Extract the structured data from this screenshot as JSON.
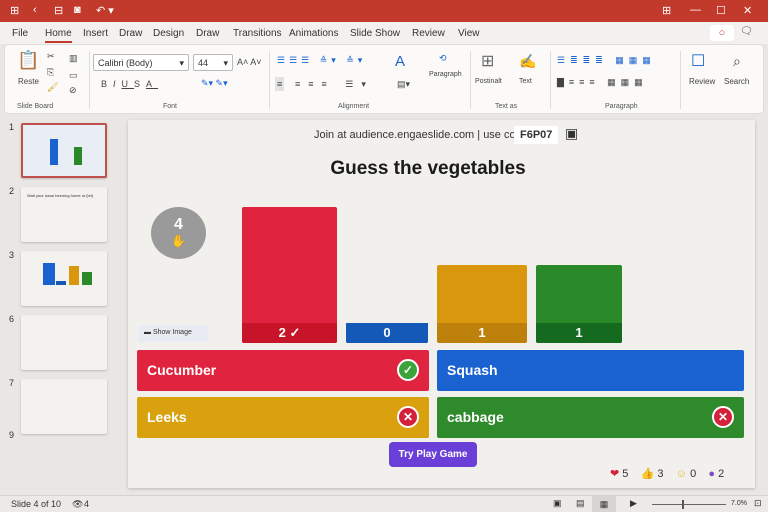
{
  "titlebar": {
    "icons": [
      "grid-icon",
      "back-icon",
      "frame-icon",
      "record-icon",
      "undo-icon"
    ],
    "window_controls": [
      "new-window",
      "minimize",
      "maximize",
      "close"
    ]
  },
  "menu": [
    "File",
    "Home",
    "Insert",
    "Draw",
    "Design",
    "Draw",
    "Transitions",
    "Animations",
    "Slide Show",
    "Review",
    "View"
  ],
  "ribbon": {
    "paste": "Reste",
    "groups": {
      "slide_board": "Slide Board",
      "font": "Font",
      "alignment": "Alignment",
      "text_as": "Text as",
      "paragraph": "Paragraph"
    },
    "font_name": "Calibri (Body)",
    "font_size": "44",
    "paragraph_btn": "Paragraph",
    "postinalt": "Postinalt",
    "text": "Text",
    "review": "Review",
    "search": "Search"
  },
  "thumbnails": [
    {
      "num": "1",
      "selected": true
    },
    {
      "num": "2",
      "title": "Wait your issue beeoing home ut (let)"
    },
    {
      "num": "3"
    },
    {
      "num": "6"
    },
    {
      "num": "7"
    },
    {
      "num": "9"
    }
  ],
  "slide": {
    "join_text": "Join at audience.engaeslide.com | use code",
    "code": "F6P07",
    "title": "Guess the vegetables",
    "responses": "4",
    "show_image": "Show Image",
    "bars": [
      {
        "value": 2,
        "label": "2 ✓",
        "color": "#e0243f",
        "dark": "#c81428"
      },
      {
        "value": 0,
        "label": "0",
        "color": "#1458b8",
        "dark": "#1458b8"
      },
      {
        "value": 1,
        "label": "1",
        "color": "#d9970d",
        "dark": "#bd800a"
      },
      {
        "value": 1,
        "label": "1",
        "color": "#2a8a2a",
        "dark": "#146a1e"
      }
    ],
    "answers": [
      {
        "text": "Cucumber",
        "color": "#e0243f",
        "mark": "correct"
      },
      {
        "text": "Squash",
        "color": "#1a62d0",
        "mark": ""
      },
      {
        "text": "Leeks",
        "color": "#d9a10d",
        "mark": "wrong"
      },
      {
        "text": "cabbage",
        "color": "#2e8a2a",
        "mark": "wrong"
      }
    ],
    "play_button": "Try Play Game",
    "reactions": [
      {
        "icon": "heart-icon",
        "count": "5"
      },
      {
        "icon": "thumbs-up-icon",
        "count": "3"
      },
      {
        "icon": "smile-icon",
        "count": "0"
      },
      {
        "icon": "surprised-icon",
        "count": "2"
      }
    ]
  },
  "status": {
    "slide": "Slide 4 of 10",
    "viewers": "4",
    "zoom": "7.0%"
  }
}
